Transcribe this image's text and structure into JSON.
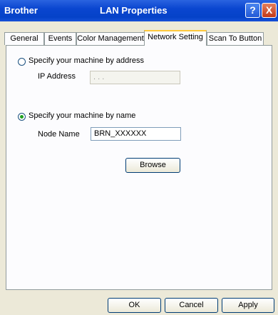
{
  "window": {
    "app_name": "Brother",
    "title": "LAN Properties",
    "help": "?",
    "close": "X"
  },
  "tabs": [
    {
      "label": "General"
    },
    {
      "label": "Events"
    },
    {
      "label": "Color Management"
    },
    {
      "label": "Network Setting",
      "active": true
    },
    {
      "label": "Scan To Button"
    }
  ],
  "address_option": {
    "label": "Specify your machine by address",
    "selected": false,
    "ip_label": "IP Address",
    "ip_value": ".    .    .",
    "ip_enabled": false
  },
  "name_option": {
    "label": "Specify your machine by name",
    "selected": true,
    "node_label": "Node Name",
    "node_value": "BRN_XXXXXX",
    "browse_label": "Browse"
  },
  "buttons": {
    "ok": "OK",
    "cancel": "Cancel",
    "apply": "Apply"
  }
}
